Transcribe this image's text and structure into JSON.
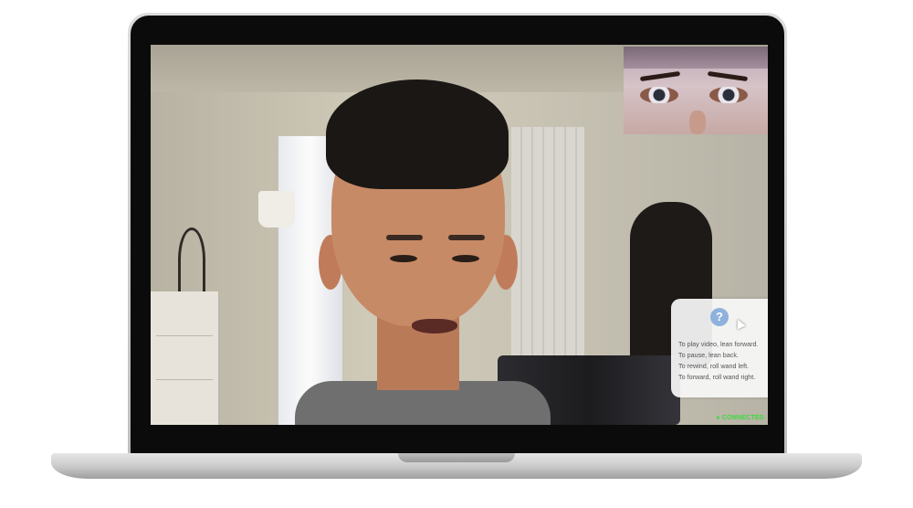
{
  "help": {
    "icon_glyph": "?",
    "lines": [
      {
        "prefix": "To play video, ",
        "action": "lean forward."
      },
      {
        "prefix": "To pause, ",
        "action": "lean back."
      },
      {
        "prefix": "To rewind, ",
        "action": "roll wand left."
      },
      {
        "prefix": "To forward, ",
        "action": "roll wand right."
      }
    ]
  },
  "status": {
    "label": "● CONNECTED",
    "color": "#3ddc3d"
  },
  "icons": {
    "help": "help-icon",
    "cursor": "cursor-icon"
  }
}
